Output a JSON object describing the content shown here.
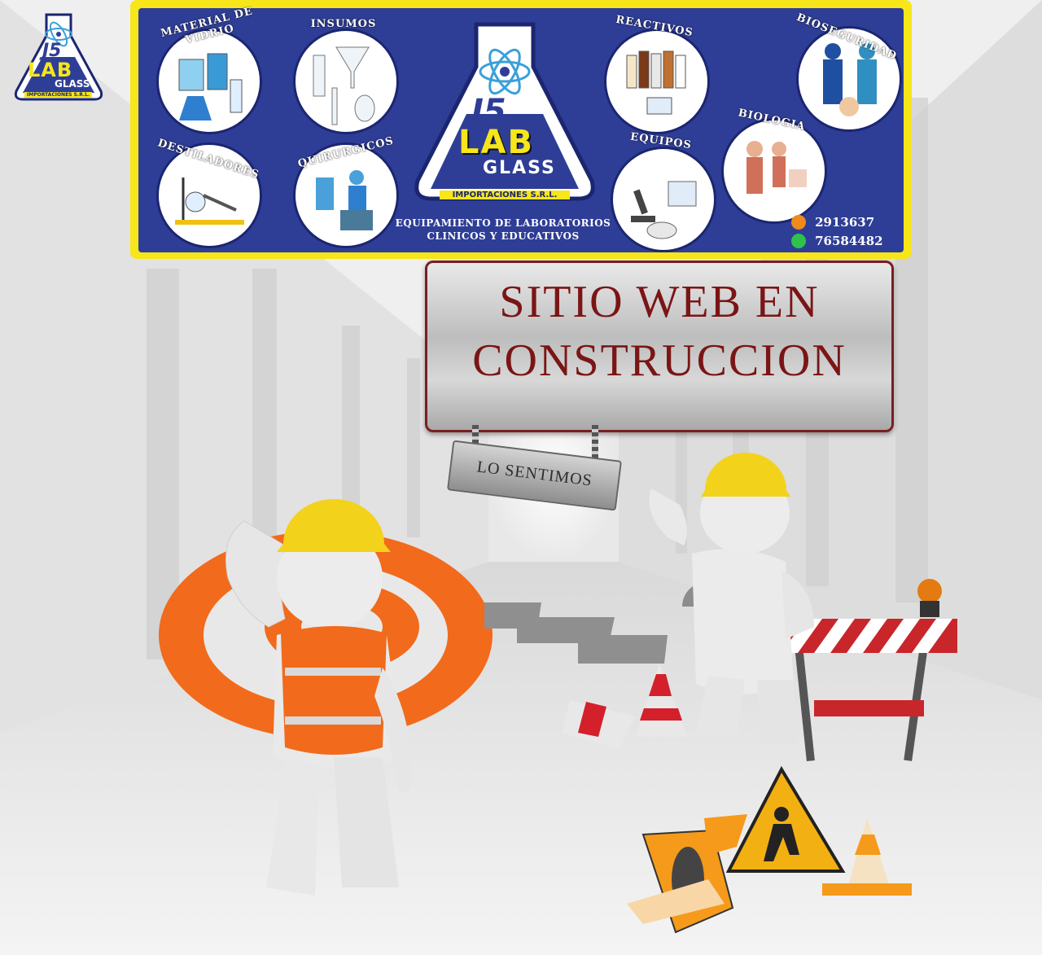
{
  "corner_logo": {
    "mark": "J5",
    "brand": "LAB",
    "sub": "GLASS",
    "tagline": "IMPORTACIONES S.R.L."
  },
  "banner": {
    "categories": [
      {
        "label": "MATERIAL DE VIDRIO",
        "icon": "glassware-icon"
      },
      {
        "label": "INSUMOS",
        "icon": "funnel-icon"
      },
      {
        "label": "DESTILADORES",
        "icon": "distiller-icon"
      },
      {
        "label": "QUIRURGICOS",
        "icon": "surgical-icon"
      },
      {
        "label": "REACTIVOS",
        "icon": "reagent-bottles-icon"
      },
      {
        "label": "EQUIPOS",
        "icon": "microscope-icon"
      },
      {
        "label": "BIOSEGURIDAD",
        "icon": "hazmat-suit-icon"
      },
      {
        "label": "BIOLOGIA",
        "icon": "anatomy-model-icon"
      }
    ],
    "center_logo": {
      "mark": "J5",
      "brand": "LAB",
      "sub": "GLASS",
      "tagline": "IMPORTACIONES S.R.L."
    },
    "slogan_line1": "EQUIPAMIENTO DE LABORATORIOS",
    "slogan_line2": "CLINICOS Y EDUCATIVOS",
    "phone": "2913637",
    "whatsapp": "76584482"
  },
  "sign": {
    "line1": "SITIO WEB EN",
    "line2": "CONSTRUCCION",
    "hanging": "LO SENTIMOS"
  },
  "colors": {
    "banner_yellow": "#f6e61a",
    "banner_blue": "#2e3e96",
    "sign_text": "#7b1515",
    "hardhat": "#f3d21b",
    "vest": "#f26a1b",
    "barrier_red": "#c8262b"
  }
}
